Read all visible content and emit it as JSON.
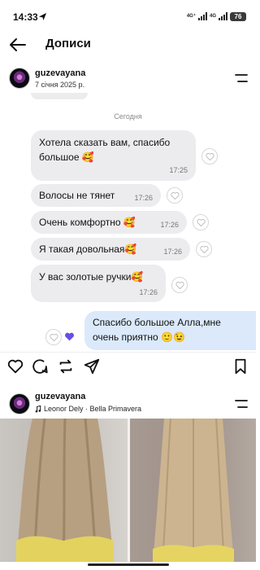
{
  "status": {
    "time": "14:33",
    "net_left": "4G⁺",
    "net_right": "4G",
    "battery": "76"
  },
  "header": {
    "title": "Дописи"
  },
  "post": {
    "username": "guzevayana",
    "date": "7 січня 2025 р.",
    "chat": {
      "day_label": "Сегодня",
      "messages": [
        {
          "text": "Хотела сказать вам, спасибо большое 🥰",
          "time": "17:25"
        },
        {
          "text": "Волосы не тянет",
          "time": "17:26"
        },
        {
          "text": "Очень комфортно 🥰",
          "time": "17:26"
        },
        {
          "text": "Я такая довольная🥰",
          "time": "17:26"
        },
        {
          "text": "У вас золотые ручки🥰",
          "time": "17:26"
        }
      ],
      "reply": {
        "text": "Спасибо большое Алла,мне очень приятно 🙂😉"
      }
    }
  },
  "next_post": {
    "username": "guzevayana",
    "music": "Leonor Dely · Bella Primavera"
  },
  "icons": [
    "back-arrow-icon",
    "menu-icon",
    "heart-icon",
    "comment-icon",
    "share-icon",
    "bookmark-icon",
    "music-note-icon",
    "send-icon"
  ],
  "colors": {
    "incoming_bubble": "#ececef",
    "outgoing_bubble": "#dbe9fb",
    "reaction_purple": "#6b4de6"
  }
}
